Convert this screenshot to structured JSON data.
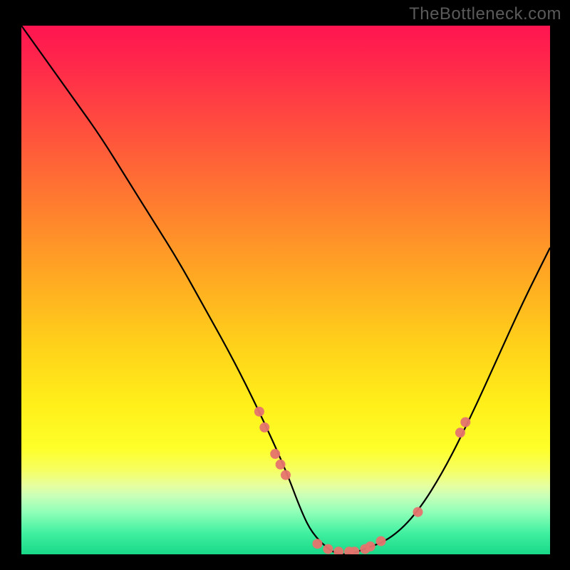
{
  "watermark": "TheBottleneck.com",
  "chart_data": {
    "type": "line",
    "title": "",
    "xlabel": "",
    "ylabel": "",
    "xlim": [
      0,
      100
    ],
    "ylim": [
      0,
      100
    ],
    "curve": {
      "comment": "Approximate V-shaped bottleneck curve; y=0 is optimal (bottom, green), y=100 is worst (top, red). x is relative position across plot width.",
      "x": [
        0,
        5,
        10,
        15,
        20,
        25,
        30,
        35,
        40,
        45,
        50,
        53,
        55,
        58,
        60,
        62,
        65,
        70,
        75,
        80,
        85,
        90,
        95,
        100
      ],
      "y": [
        100,
        93,
        86,
        79,
        71,
        63,
        55,
        46,
        37,
        27,
        16,
        8,
        4,
        1,
        0,
        0,
        1,
        3,
        8,
        16,
        26,
        37,
        48,
        58
      ]
    },
    "markers": {
      "comment": "Salmon-colored dots near the trough of the curve",
      "color": "#e6746e",
      "points": [
        {
          "x": 45,
          "y": 27
        },
        {
          "x": 46,
          "y": 24
        },
        {
          "x": 48,
          "y": 19
        },
        {
          "x": 49,
          "y": 17
        },
        {
          "x": 50,
          "y": 15
        },
        {
          "x": 56,
          "y": 2
        },
        {
          "x": 58,
          "y": 1
        },
        {
          "x": 60,
          "y": 0.5
        },
        {
          "x": 62,
          "y": 0.5
        },
        {
          "x": 63,
          "y": 0.5
        },
        {
          "x": 65,
          "y": 1
        },
        {
          "x": 66,
          "y": 1.5
        },
        {
          "x": 68,
          "y": 2.5
        },
        {
          "x": 75,
          "y": 8
        },
        {
          "x": 83,
          "y": 23
        },
        {
          "x": 84,
          "y": 25
        }
      ]
    },
    "gradient_meaning": "background color encodes bottleneck severity: red (top) = high bottleneck, green (bottom) = no bottleneck"
  }
}
